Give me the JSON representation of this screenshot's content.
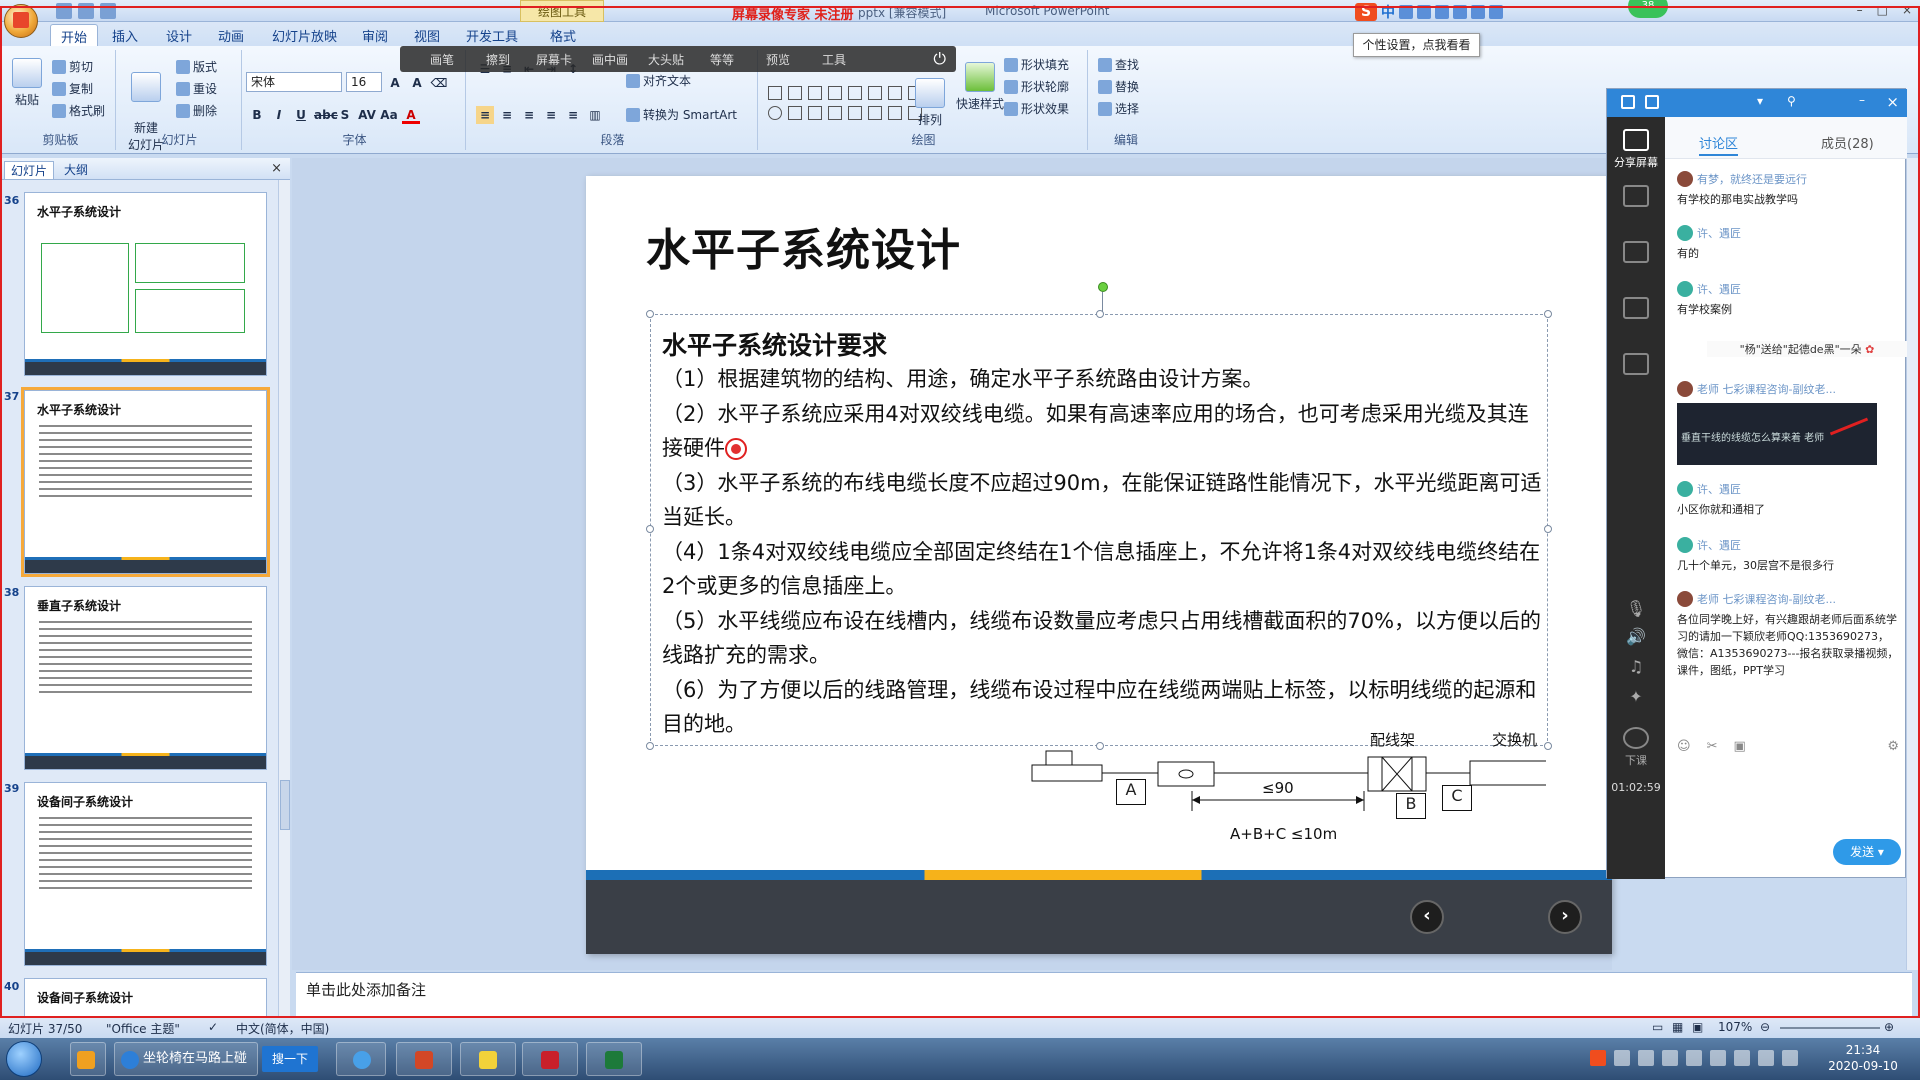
{
  "window": {
    "recording_title": "屏幕录像专家 未注册",
    "title_mid": "pptx [兼容模式]",
    "app_name": "Microsoft PowerPoint",
    "tools_tab": "绘图工具",
    "badge": "38"
  },
  "tooltip": "个性设置，点我看看",
  "ribbon_tabs": [
    "开始",
    "插入",
    "设计",
    "动画",
    "幻灯片放映",
    "审阅",
    "视图",
    "开发工具",
    "格式"
  ],
  "float_toolbar": [
    "画笔",
    "擦到",
    "屏幕卡",
    "画中画",
    "大头贴",
    "等等",
    "预览",
    "工具"
  ],
  "ribbon": {
    "clipboard": {
      "label": "剪贴板",
      "paste": "粘贴",
      "cut": "剪切",
      "copy": "复制",
      "format_painter": "格式刷"
    },
    "slides": {
      "label": "幻灯片",
      "new_slide": "新建\n幻灯片",
      "layout": "版式",
      "reset": "重设",
      "delete": "删除"
    },
    "font": {
      "label": "字体",
      "name": "宋体",
      "size": "16"
    },
    "paragraph": {
      "label": "段落",
      "align_text": "对齐文本",
      "smartart": "转换为 SmartArt"
    },
    "drawing": {
      "label": "绘图",
      "arrange": "排列",
      "quick_styles": "快速样式",
      "shape_fill": "形状填充",
      "shape_outline": "形状轮廓",
      "shape_effects": "形状效果"
    },
    "editing": {
      "label": "编辑",
      "find": "查找",
      "replace": "替换",
      "select": "选择"
    }
  },
  "left_panel": {
    "tabs": [
      "幻灯片",
      "大纲"
    ],
    "close": "×",
    "thumbnails": [
      {
        "num": "36",
        "title": "水平子系统设计"
      },
      {
        "num": "37",
        "title": "水平子系统设计"
      },
      {
        "num": "38",
        "title": "垂直子系统设计"
      },
      {
        "num": "39",
        "title": "设备间子系统设计"
      },
      {
        "num": "40",
        "title": "设备间子系统设计"
      }
    ]
  },
  "slide": {
    "title": "水平子系统设计",
    "subtitle": "水平子系统设计要求",
    "items": [
      "（1）根据建筑物的结构、用途，确定水平子系统路由设计方案。",
      "（2）水平子系统应采用4对双绞线电缆。如果有高速率应用的场合，也可考虑采用光缆及其连接硬件",
      "（3）水平子系统的布线电缆长度不应超过90m，在能保证链路性能情况下，水平光缆距离可适当延长。",
      "（4）1条4对双绞线电缆应全部固定终结在1个信息插座上，不允许将1条4对双绞线电缆终结在2个或更多的信息插座上。",
      "（5）水平线缆应布设在线槽内，线缆布设数量应考虑只占用线槽截面积的70%，以方便以后的线路扩充的需求。",
      "（6）为了方便以后的线路管理，线缆布设过程中应在线缆两端贴上标签，以标明线缆的起源和目的地。"
    ],
    "diagram": {
      "patch_panel": "配线架",
      "switch": "交换机",
      "label_a": "A",
      "label_b": "B",
      "label_c": "C",
      "length": "≤90",
      "formula": "A+B+C ≤10m"
    },
    "prev": "‹",
    "next": "›"
  },
  "notes_placeholder": "单击此处添加备注",
  "chat": {
    "tabs": [
      "讨论区",
      "成员(28)"
    ],
    "side": [
      "分享屏幕",
      "下课"
    ],
    "timer": "01:02:59",
    "messages": [
      {
        "who": "有梦，就终还是要远行",
        "text": "有学校的那电实战教学吗"
      },
      {
        "who": "许、遇匠",
        "text": "有的"
      },
      {
        "who": "许、遇匠",
        "text": "有学校案例"
      },
      {
        "system": "\"杨\"送给\"起德de黑\"一朵"
      },
      {
        "who": "老师 七彩课程咨询-副纹老...",
        "image": "垂直干线的线缆怎么算来着 老师"
      },
      {
        "who": "许、遇匠",
        "text": "小区你就和通相了"
      },
      {
        "who": "许、遇匠",
        "text": "几十个单元，30层宫不是很多行"
      },
      {
        "who": "老师 七彩课程咨询-副纹老...",
        "text": "各位同学晚上好，有兴趣跟胡老师后面系统学习的请加一下颖欣老师QQ:1353690273，微信：A1353690273---报名获取录播视频，课件，图纸，PPT学习"
      }
    ],
    "send": "发送"
  },
  "statusbar": {
    "slide_info": "幻灯片 37/50",
    "theme": "\"Office 主题\"",
    "language": "中文(简体，中国)",
    "zoom": "107%"
  },
  "taskbar": {
    "ie_item": "坐轮椅在马路上碰瓷",
    "search_btn": "搜一下",
    "time": "21:34",
    "date": "2020-09-10"
  }
}
